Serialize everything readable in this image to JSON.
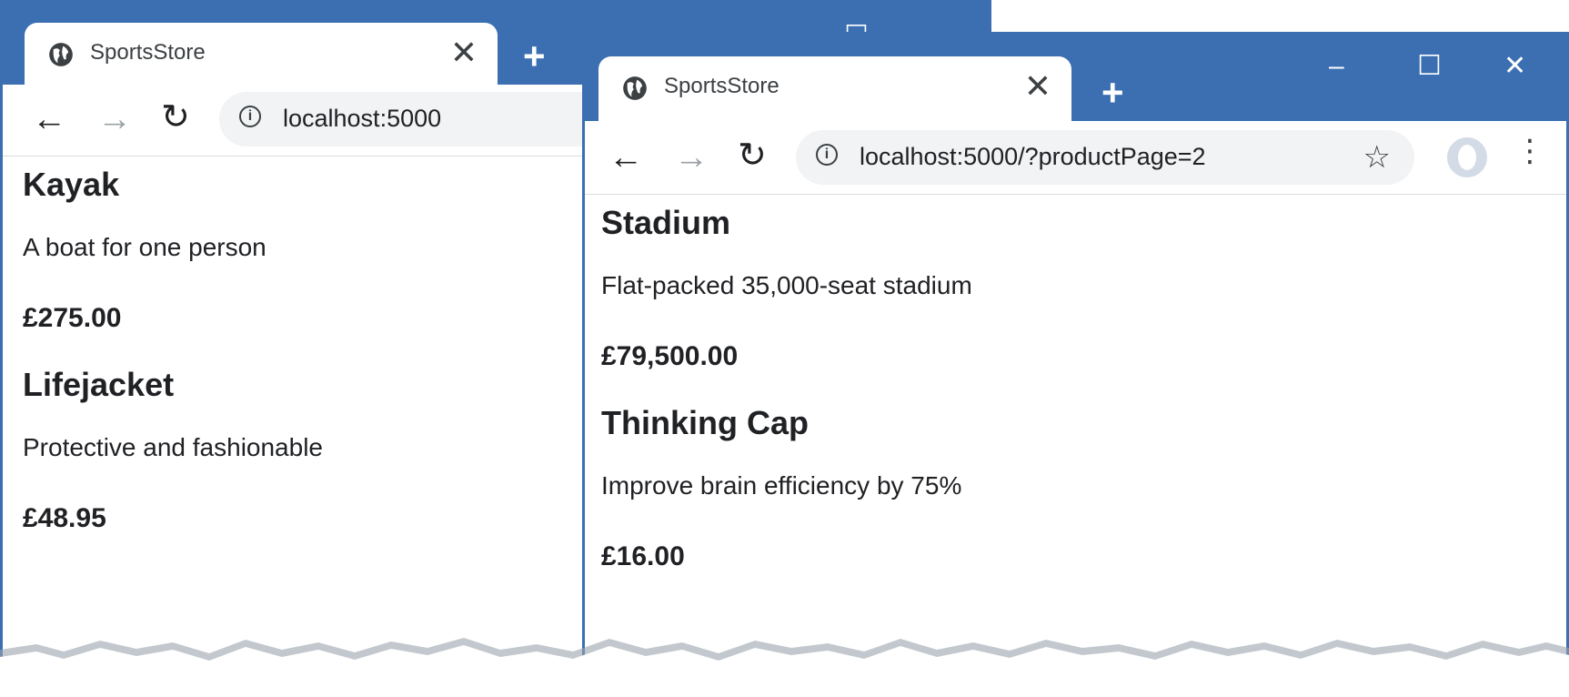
{
  "windows": [
    {
      "tab_title": "SportsStore",
      "url": "localhost:5000",
      "products": [
        {
          "name": "Kayak",
          "description": "A boat for one person",
          "price": "£275.00"
        },
        {
          "name": "Lifejacket",
          "description": "Protective and fashionable",
          "price": "£48.95"
        }
      ]
    },
    {
      "tab_title": "SportsStore",
      "url": "localhost:5000/?productPage=2",
      "products": [
        {
          "name": "Stadium",
          "description": "Flat-packed 35,000-seat stadium",
          "price": "£79,500.00"
        },
        {
          "name": "Thinking Cap",
          "description": "Improve brain efficiency by 75%",
          "price": "£16.00"
        }
      ]
    }
  ],
  "icons": {
    "tab_icon": "globe-icon",
    "close": "close-icon",
    "new_tab": "plus-icon",
    "back": "back-arrow-icon",
    "forward": "forward-arrow-icon",
    "reload": "reload-icon",
    "site_info": "info-icon",
    "bookmark": "star-icon",
    "profile": "avatar-icon",
    "menu": "kebab-menu-icon",
    "minimize": "minimize-icon",
    "maximize": "maximize-icon",
    "window_close": "window-close-icon"
  },
  "colors": {
    "titlebar": "#3b6fb1",
    "omnibox": "#f1f3f4",
    "text": "#202124"
  }
}
